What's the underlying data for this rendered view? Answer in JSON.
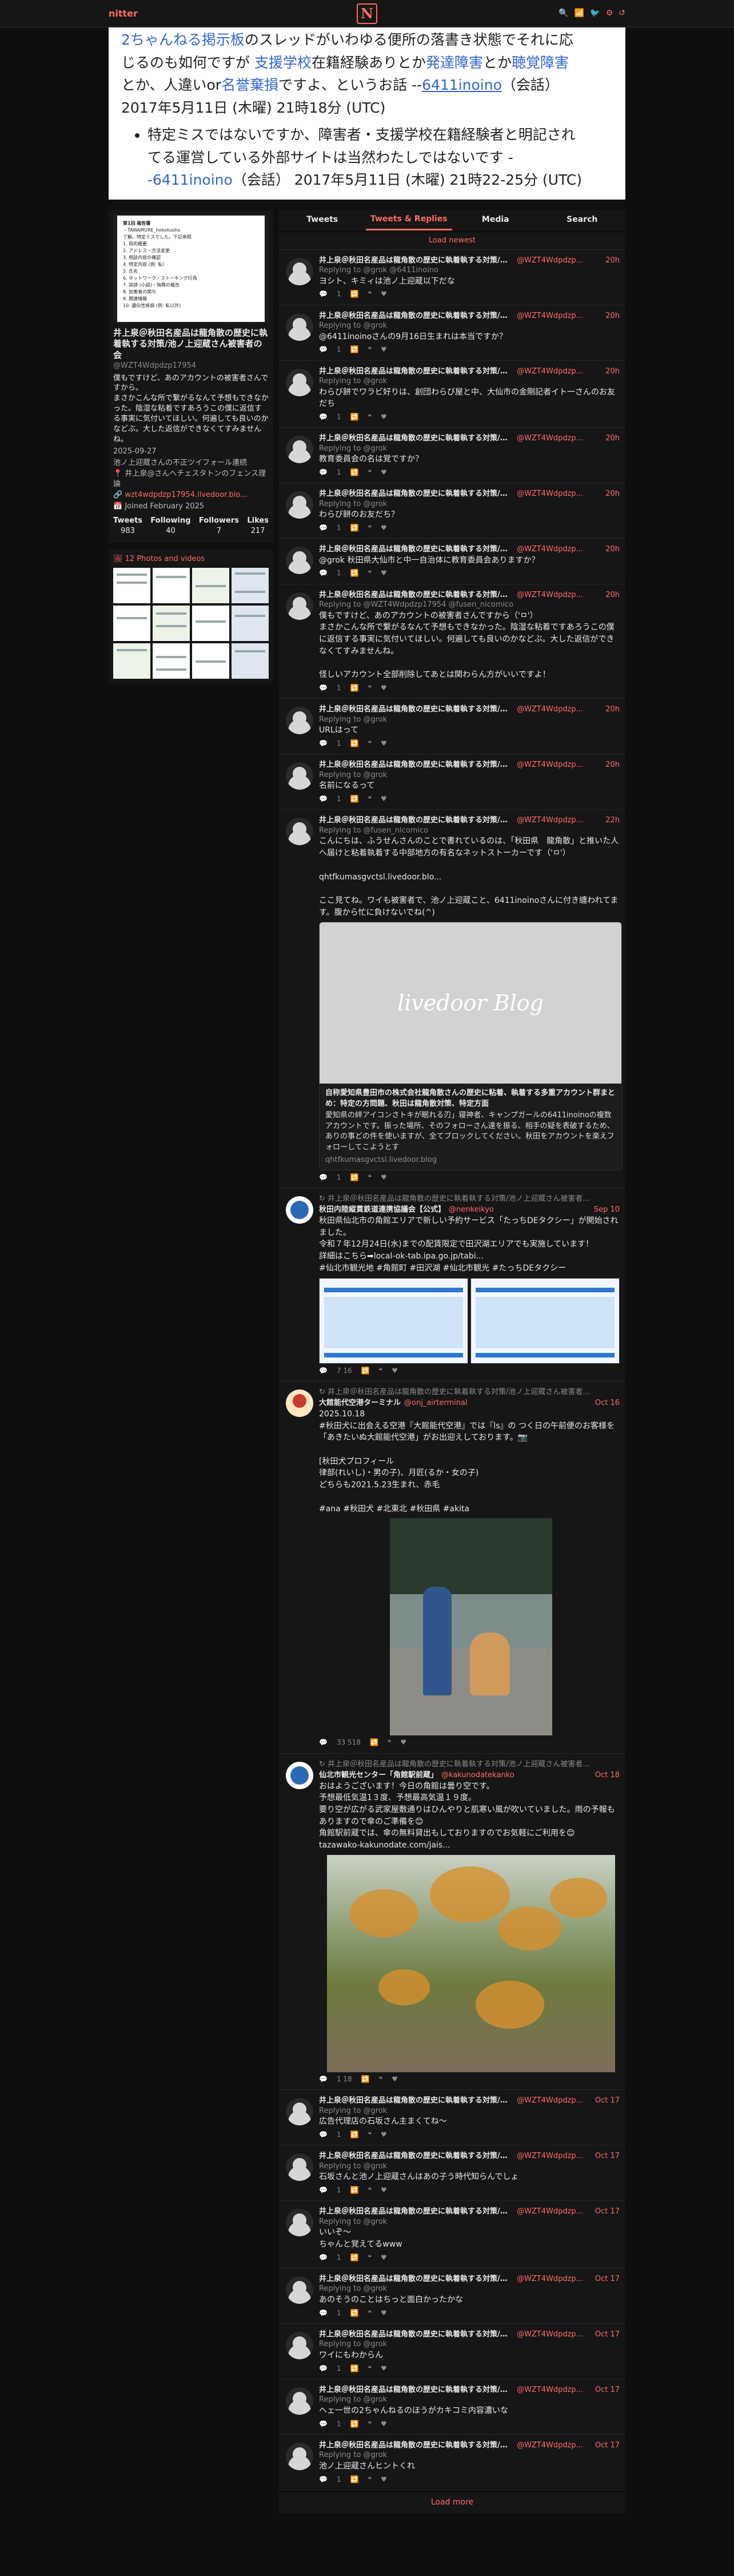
{
  "nav": {
    "brand": "nitter",
    "logo": "N",
    "icons": [
      "🔍",
      "📶",
      "🐦",
      "⚙",
      "↺"
    ]
  },
  "wiki": {
    "line1a": "2ちゃんねる掲示板",
    "line1b": "のスレッドがいわゆる便所の落書き状態でそれに応",
    "line2a": "じるのも如何ですが ",
    "line2b": "支援学校",
    "line2c": "在籍経験ありとか",
    "line2d": "発達障害",
    "line2e": "とか",
    "line2f": "聴覚障害",
    "line3a": "とか、人違いor",
    "line3b": "名誉棄損",
    "line3c": "ですよ、というお話 --",
    "line3d": "6411inoino",
    "line3e": "（会話）",
    "line4": "2017年5月11日 (木曜) 21時18分 (UTC)",
    "bullet1a": "特定ミスではないですか、障害者・支援学校在籍経験者と明記され",
    "bullet1b": "てる運営している外部サイトは当然わたしではないです -",
    "bullet1c": "-6411inoino",
    "bullet1d": "（会話）",
    "bullet1e": " 2017年5月11日 (木曜) 21時22-25分 (UTC)"
  },
  "profile": {
    "banner_lines": [
      "第1回 報告書",
      "・TAWAMURE_hokokusho",
      "了解。特定ミスでした。下記参照",
      "",
      "1. 目的概要",
      "2. アドレス・方法変更",
      "3. 相談内容の確認",
      "4. 特定内容 (例: 私)",
      "5. 氏名",
      "6. ネットワーク・ストーキング行為",
      "7. 誹謗 (小説)・侮辱の報告",
      "8. 加害者の関与",
      "9. 関連情報",
      "10. 遺伝性疾病 (例: 私以外)"
    ],
    "name": "井上泉＠秋田名産品は龍角散の歴史に執着執する対策/池ノ上迎蔵さん被害者の会",
    "username": "@WZT4Wdpdzp17954",
    "bio": "僕もですけど、あのアカウントの被害者さんですから。\nまさかこんな所で繋がるなんて予想もできなかった。陰湿な粘着ですあろうこの僕に返信する事実に気付いてほしい。何遍しても良いのかなどぶ。大した返信ができなくてすみませんね。",
    "date": "2025-09-27",
    "tagline": "池ノ上迎蔵さんの不正ツイフォール連続",
    "location": "井上泉@さんへチェスタトンのフェンス理論",
    "link": "wzt4wdpdzp17954.livedoor.blo...",
    "joined": "Joined February 2025",
    "stats": [
      {
        "label": "Tweets",
        "value": "983"
      },
      {
        "label": "Following",
        "value": "40"
      },
      {
        "label": "Followers",
        "value": "7"
      },
      {
        "label": "Likes",
        "value": "217"
      }
    ],
    "media_label": "12 Photos and videos"
  },
  "tabs": [
    "Tweets",
    "Tweets & Replies",
    "Media",
    "Search"
  ],
  "load_newest": "Load newest",
  "load_more": "Load more",
  "tweets": [
    {
      "name": "井上泉＠秋田名産品は龍角散の歴史に執着執する対策/池ノ上迎蔵さん被害者...",
      "user": "@WZT4Wdpdzp...",
      "date": "20h",
      "reply_to": "Replying to @grok @6411inoino",
      "text": "ヨシト、キミィは池ノ上迎蔵以下だな",
      "stats": "1"
    },
    {
      "name": "井上泉＠秋田名産品は龍角散の歴史に執着執する対策/池ノ上迎蔵さん被害者...",
      "user": "@WZT4Wdpdzp...",
      "date": "20h",
      "reply_to": "Replying to @grok",
      "text": "@6411inoinoさんの9月16日生まれは本当ですか？",
      "stats": "1"
    },
    {
      "name": "井上泉＠秋田名産品は龍角散の歴史に執着執する対策/池ノ上迎蔵さん被害者...",
      "user": "@WZT4Wdpdzp...",
      "date": "20h",
      "reply_to": "Replying to @grok",
      "text": "わらび餅でワラビ好りは、創団わらび屋と中、大仙市の金剛記者イト一さんのお友だち",
      "stats": "1"
    },
    {
      "name": "井上泉＠秋田名産品は龍角散の歴史に執着執する対策/池ノ上迎蔵さん被害者...",
      "user": "@WZT4Wdpdzp...",
      "date": "20h",
      "reply_to": "Replying to @grok",
      "text": "教育委員会の名は覚ですか？",
      "stats": "1"
    },
    {
      "name": "井上泉＠秋田名産品は龍角散の歴史に執着執する対策/池ノ上迎蔵さん被害者...",
      "user": "@WZT4Wdpdzp...",
      "date": "20h",
      "reply_to": "Replying to @grok",
      "text": "わらび餅のお友だち？",
      "stats": "1"
    },
    {
      "name": "井上泉＠秋田名産品は龍角散の歴史に執着執する対策/池ノ上迎蔵さん被害者...",
      "user": "@WZT4Wdpdzp...",
      "date": "20h",
      "reply_to": "",
      "text": "@grok 秋田県大仙市と中一自治体に教育委員会ありますか？",
      "stats": "1"
    },
    {
      "name": "井上泉＠秋田名産品は龍角散の歴史に執着執する対策/池ノ上迎蔵さん被害者...",
      "user": "@WZT4Wdpdzp...",
      "date": "20h",
      "reply_to": "Replying to @WZT4Wdpdzp17954 @fusen_nicomico",
      "text": "僕もですけど、あのアカウントの被害者さんですから（'ㅁ'）\nまさかこんな所で繋がるなんて予想もできなかった。陰湿な粘着ですあろうこの僕に返信する事実に気付いてほしい。何遍しても良いのかなどぶ。大した返信ができなくてすみませんね。\n\n怪しいアカウント全部削除してあとは関わらん方がいいですよ！",
      "stats": "1"
    },
    {
      "name": "井上泉＠秋田名産品は龍角散の歴史に執着執する対策/池ノ上迎蔵さん被害者...",
      "user": "@WZT4Wdpdzp...",
      "date": "20h",
      "reply_to": "Replying to @grok",
      "text": "URLはって",
      "stats": "1"
    },
    {
      "name": "井上泉＠秋田名産品は龍角散の歴史に執着執する対策/池ノ上迎蔵さん被害者...",
      "user": "@WZT4Wdpdzp...",
      "date": "20h",
      "reply_to": "Replying to @grok",
      "text": "名前になるって",
      "stats": "1"
    },
    {
      "name": "井上泉＠秋田名産品は龍角散の歴史に執着執する対策/池ノ上迎蔵さん被害者...",
      "user": "@WZT4Wdpdzp...",
      "date": "22h",
      "reply_to": "Replying to @fusen_nicomico",
      "text": "こんにちは、ふうせんさんのことで書れているのは、「秋田県　龍角散」と推いた人へ届けと粘着執着する中部地方の有名なネットストーカーです（'ㅁ'）\n\nqhtfkumasgvctsl.livedoor.blo...\n\nここ見てね。ワイも被害者で、池ノ上迎蔵こと、6411inoinoさんに付き纏われてます。腹から忙に負けないでね(^)",
      "stats": "1",
      "card": {
        "img": "livedoor Blog",
        "title": "自称愛知県豊田市の株式会社龍角散さんの歴史に粘着、執着する多重アカウント群まとめ：特定の方問題、秋田は龍角散対策、特定方面",
        "desc": "愛知県の絆アイコンさトキが眠れる刃」寝神者、キャンプガールの6411inoinoの複数アカウントです。振った場所、そのフォローさん達を振る、相手の疑を表破するため、ありの事どの件を使いますが、全てブロックしてください。秋田をアカウントを楽えフォローしてこようとす",
        "domain": "qhtfkumasgvctsl.livedoor.blog"
      }
    },
    {
      "retweet": "井上泉＠秋田名産品は龍角散の歴史に執着執する対策/池ノ上迎蔵さん被害者...",
      "org": "1",
      "name": "秋田内陸縦貫鉄道連携協議会【公式】",
      "user": "@nenkeikyo",
      "date": "Sep 10",
      "reply_to": "",
      "text": "秋田県仙北市の角館エリアで新しい予約サービス「たっちDEタクシー」が開始されました。\n令和７年12月24日(水)までの配賃限定で田沢湖エリアでも実施しています！\n詳細はこちら➡local-ok-tab.ipa.go.jp/tabi...\n#仙北市観光地 #角館町 #田沢湖 #仙北市観光 #たっちDEタクシー",
      "stats": "7   16",
      "posters": [
        "poster1",
        "poster2"
      ]
    },
    {
      "retweet": "井上泉＠秋田名産品は龍角散の歴史に執着執する対策/池ノ上迎蔵さん被害者...",
      "org": "2",
      "name": "大館能代空港ターミナル",
      "user": "@onj_airterminal",
      "date": "Oct 16",
      "reply_to": "",
      "text": "2025.10.18\n#秋田犬に出会える空港『大館能代空港』では『ls』の つく日の午前便のお客様を「あきたいぬ大館能代空港」がお出迎えしております。📷\n\n[秋田犬プロフィール\n律部(れいし)・男の子)、月匠(るか・女の子)\nどちらも2021.5.23生まれ、赤毛\n\n#ana #秋田犬 #北東北 #秋田県 #akita",
      "stats": "33   518",
      "photo": "dog"
    },
    {
      "retweet": "井上泉＠秋田名産品は龍角散の歴史に執着執する対策/池ノ上迎蔵さん被害者...",
      "org": "1",
      "name": "仙北市観光センター「角館駅前蔵」",
      "user": "@kakunodatekanko",
      "date": "Oct 18",
      "reply_to": "",
      "text": "おはようございます！今日の角館は曇り空です。\n予想最低気温1３度、予想最高気温１９度。\n要り空が広がる武家屋敷通りはひんやりと肌寒い風が吹いていました。雨の予報もありますので傘のご準備を😊\n角館駅前蔵では、傘の無料貸出もしておりますのでお気軽にご利用を😊\ntazawako-kakunodate.com/jais...",
      "stats": "1   18",
      "photo": "tree"
    },
    {
      "name": "井上泉＠秋田名産品は龍角散の歴史に執着執する対策/池ノ上迎蔵さん被害者...",
      "user": "@WZT4Wdpdzp...",
      "date": "Oct 17",
      "reply_to": "Replying to @grok",
      "text": "広告代理店の石坂さん主まくてね～",
      "stats": "1"
    },
    {
      "name": "井上泉＠秋田名産品は龍角散の歴史に執着執する対策/池ノ上迎蔵さん被害者...",
      "user": "@WZT4Wdpdzp...",
      "date": "Oct 17",
      "reply_to": "Replying to @grok",
      "text": "石坂さんと池ノ上迎蔵さんはあの子う時代知らんでしょ",
      "stats": "1"
    },
    {
      "name": "井上泉＠秋田名産品は龍角散の歴史に執着執する対策/池ノ上迎蔵さん被害者...",
      "user": "@WZT4Wdpdzp...",
      "date": "Oct 17",
      "reply_to": "Replying to @grok",
      "text": "いいぞ～\nちゃんと覚えてるwww",
      "stats": "1"
    },
    {
      "name": "井上泉＠秋田名産品は龍角散の歴史に執着執する対策/池ノ上迎蔵さん被害者...",
      "user": "@WZT4Wdpdzp...",
      "date": "Oct 17",
      "reply_to": "Replying to @grok",
      "text": "あのそうのことはちっと面白かったかな",
      "stats": "1"
    },
    {
      "name": "井上泉＠秋田名産品は龍角散の歴史に執着執する対策/池ノ上迎蔵さん被害者...",
      "user": "@WZT4Wdpdzp...",
      "date": "Oct 17",
      "reply_to": "Replying to @grok",
      "text": "ワイにもわからん",
      "stats": "1"
    },
    {
      "name": "井上泉＠秋田名産品は龍角散の歴史に執着執する対策/池ノ上迎蔵さん被害者...",
      "user": "@WZT4Wdpdzp...",
      "date": "Oct 17",
      "reply_to": "Replying to @grok",
      "text": "ヘェ一世の2ちゃんねるのほうがカキコミ内容濃いな",
      "stats": "1"
    },
    {
      "name": "井上泉＠秋田名産品は龍角散の歴史に執着執する対策/池ノ上迎蔵さん被害者...",
      "user": "@WZT4Wdpdzp...",
      "date": "Oct 17",
      "reply_to": "Replying to @grok",
      "text": "池ノ上迎蔵さんヒントくれ",
      "stats": "1"
    }
  ]
}
